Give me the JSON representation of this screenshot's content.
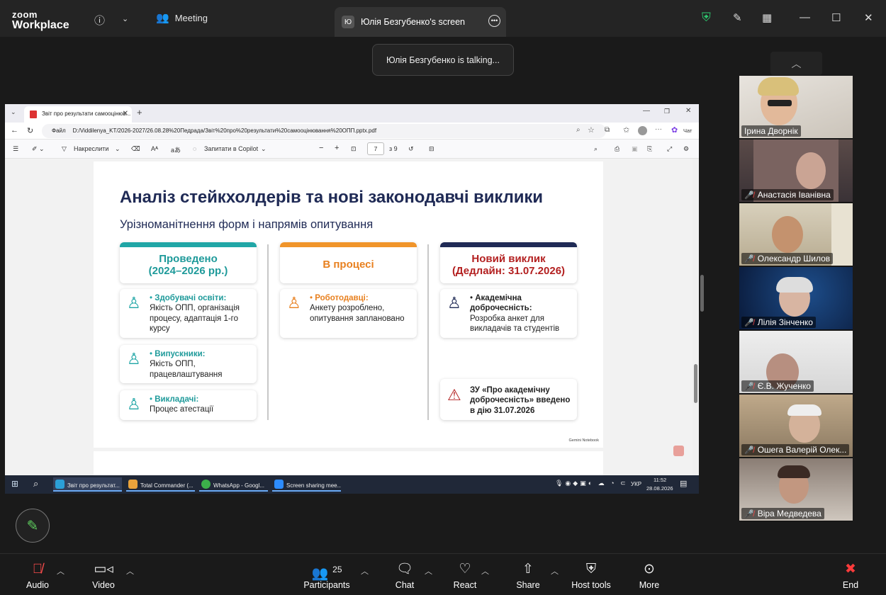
{
  "zoom": {
    "brand_top": "zoom",
    "brand_bottom": "Workplace",
    "meeting_label": "Meeting",
    "screen_tab": "Юлія Безгубенко's screen",
    "avatar_initial": "Ю",
    "talking": "Юлія Безгубенко is talking..."
  },
  "browser": {
    "tab_title": "Звіт про результати самооцінюв...",
    "url_prefix": "Файл",
    "url": "D:/Viddilenya_KT/2026-2027/26.08.28%20Педрада/Звіт%20про%20результати%20самооцінювання%20ОПП.pptx.pdf",
    "copilot_label": "Чат"
  },
  "pdf_toolbar": {
    "draw": "Накреслити",
    "ask_copilot": "Запитати в Copilot",
    "page": "7",
    "of_pages": "з 9"
  },
  "slide": {
    "title": "Аналіз стейкхолдерів та нові законодавчі виклики",
    "subtitle": "Урізноманітнення форм і напрямів опитування",
    "col1_header": "Проведено (2024–2026 рр.)",
    "col2_header": "В процесі",
    "col3_header": "Новий виклик (Дедлайн: 31.07.2026)",
    "card1_bold": "Здобувачі освіти:",
    "card1_text": "Якість ОПП, організація процесу, адаптація 1-го курсу",
    "card2_bold": "Випускники:",
    "card2_text": "Якість ОПП, працевлаштування",
    "card3_bold": "Викладачі:",
    "card3_text": "Процес атестації",
    "card4_bold": "Роботодавці:",
    "card4_text": "Анкету розроблено, опитування заплановано",
    "card5_bold": "Академічна доброчесність:",
    "card5_text": "Розробка анкет для викладачів та студентів",
    "card6_pre": "ЗУ «Про академічну доброчесність» введено в дію ",
    "card6_date": "31.07.2026",
    "gemini": "Gemini Notebook"
  },
  "taskbar": {
    "items": [
      "Звіт про результат...",
      "Total Commander (...",
      "WhatsApp - Googl...",
      "Screen sharing mee..."
    ],
    "lang": "УКР",
    "time": "11:52",
    "date": "28.08.2026"
  },
  "participants": [
    "Ірина Дворнік",
    "Анастасія Іванівна",
    "Олександр Шилов",
    "Лілія Зінченко",
    "Є.В. Жученко",
    "Ошега Валерій Олек...",
    "Віра Медведева"
  ],
  "controls": {
    "audio": "Audio",
    "video": "Video",
    "participants": "Participants",
    "participants_count": "25",
    "chat": "Chat",
    "react": "React",
    "share": "Share",
    "host_tools": "Host tools",
    "more": "More",
    "end": "End"
  },
  "colors": {
    "accent_teal": "#20a6a6",
    "accent_orange": "#f0942a",
    "accent_navy": "#1f2a55",
    "danger": "#b32020"
  }
}
